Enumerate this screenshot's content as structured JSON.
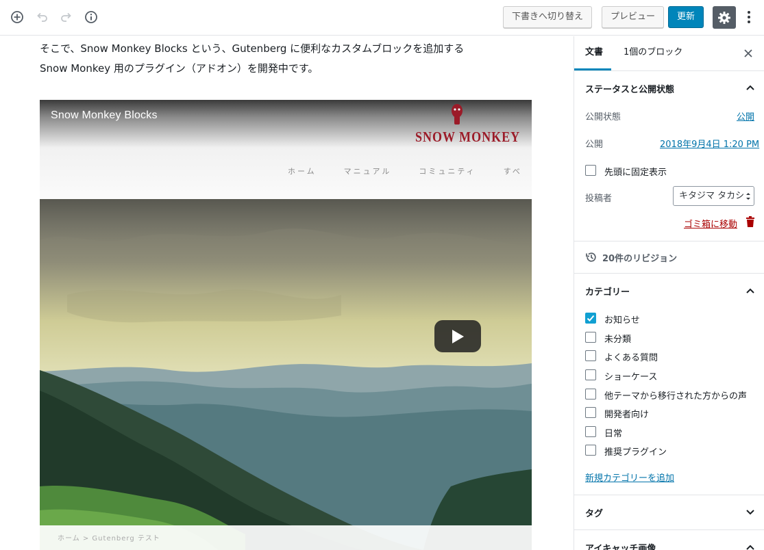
{
  "toolbar": {
    "switch_to_draft": "下書きへ切り替え",
    "preview": "プレビュー",
    "update": "更新"
  },
  "editor": {
    "paragraph_line1": "そこで、Snow Monkey Blocks という、Gutenberg に便利なカスタムブロックを追加する",
    "paragraph_line2": "Snow Monkey 用のプラグイン（アドオン）を開発中です。",
    "video": {
      "title": "Snow Monkey Blocks",
      "logo_text": "SNOW MONKEY",
      "nav": [
        "ホーム",
        "マニュアル",
        "コミュニティ",
        "すべ"
      ],
      "footer_text": "ホーム > Gutenberg テスト"
    }
  },
  "sidebar": {
    "tabs": [
      "文書",
      "1個のブロック"
    ],
    "status_panel": {
      "title": "ステータスと公開状態",
      "visibility_label": "公開状態",
      "visibility_value": "公開",
      "publish_label": "公開",
      "publish_value": "2018年9月4日 1:20 PM",
      "sticky_label": "先頭に固定表示",
      "author_label": "投稿者",
      "author_value": "キタジマ タカシ",
      "trash_label": "ゴミ箱に移動"
    },
    "revisions_label": "20件のリビジョン",
    "categories_panel": {
      "title": "カテゴリー",
      "items": [
        {
          "label": "お知らせ",
          "checked": true
        },
        {
          "label": "未分類",
          "checked": false
        },
        {
          "label": "よくある質問",
          "checked": false
        },
        {
          "label": "ショーケース",
          "checked": false
        },
        {
          "label": "他テーマから移行された方からの声",
          "checked": false
        },
        {
          "label": "開発者向け",
          "checked": false
        },
        {
          "label": "日常",
          "checked": false
        },
        {
          "label": "推奨プラグイン",
          "checked": false
        }
      ],
      "add_new": "新規カテゴリーを追加"
    },
    "tags_title": "タグ",
    "featured_image_title": "アイキャッチ画像"
  },
  "colors": {
    "primary": "#0085ba",
    "link": "#0073aa",
    "danger": "#a00",
    "checkbox_checked": "#11a0d2"
  }
}
